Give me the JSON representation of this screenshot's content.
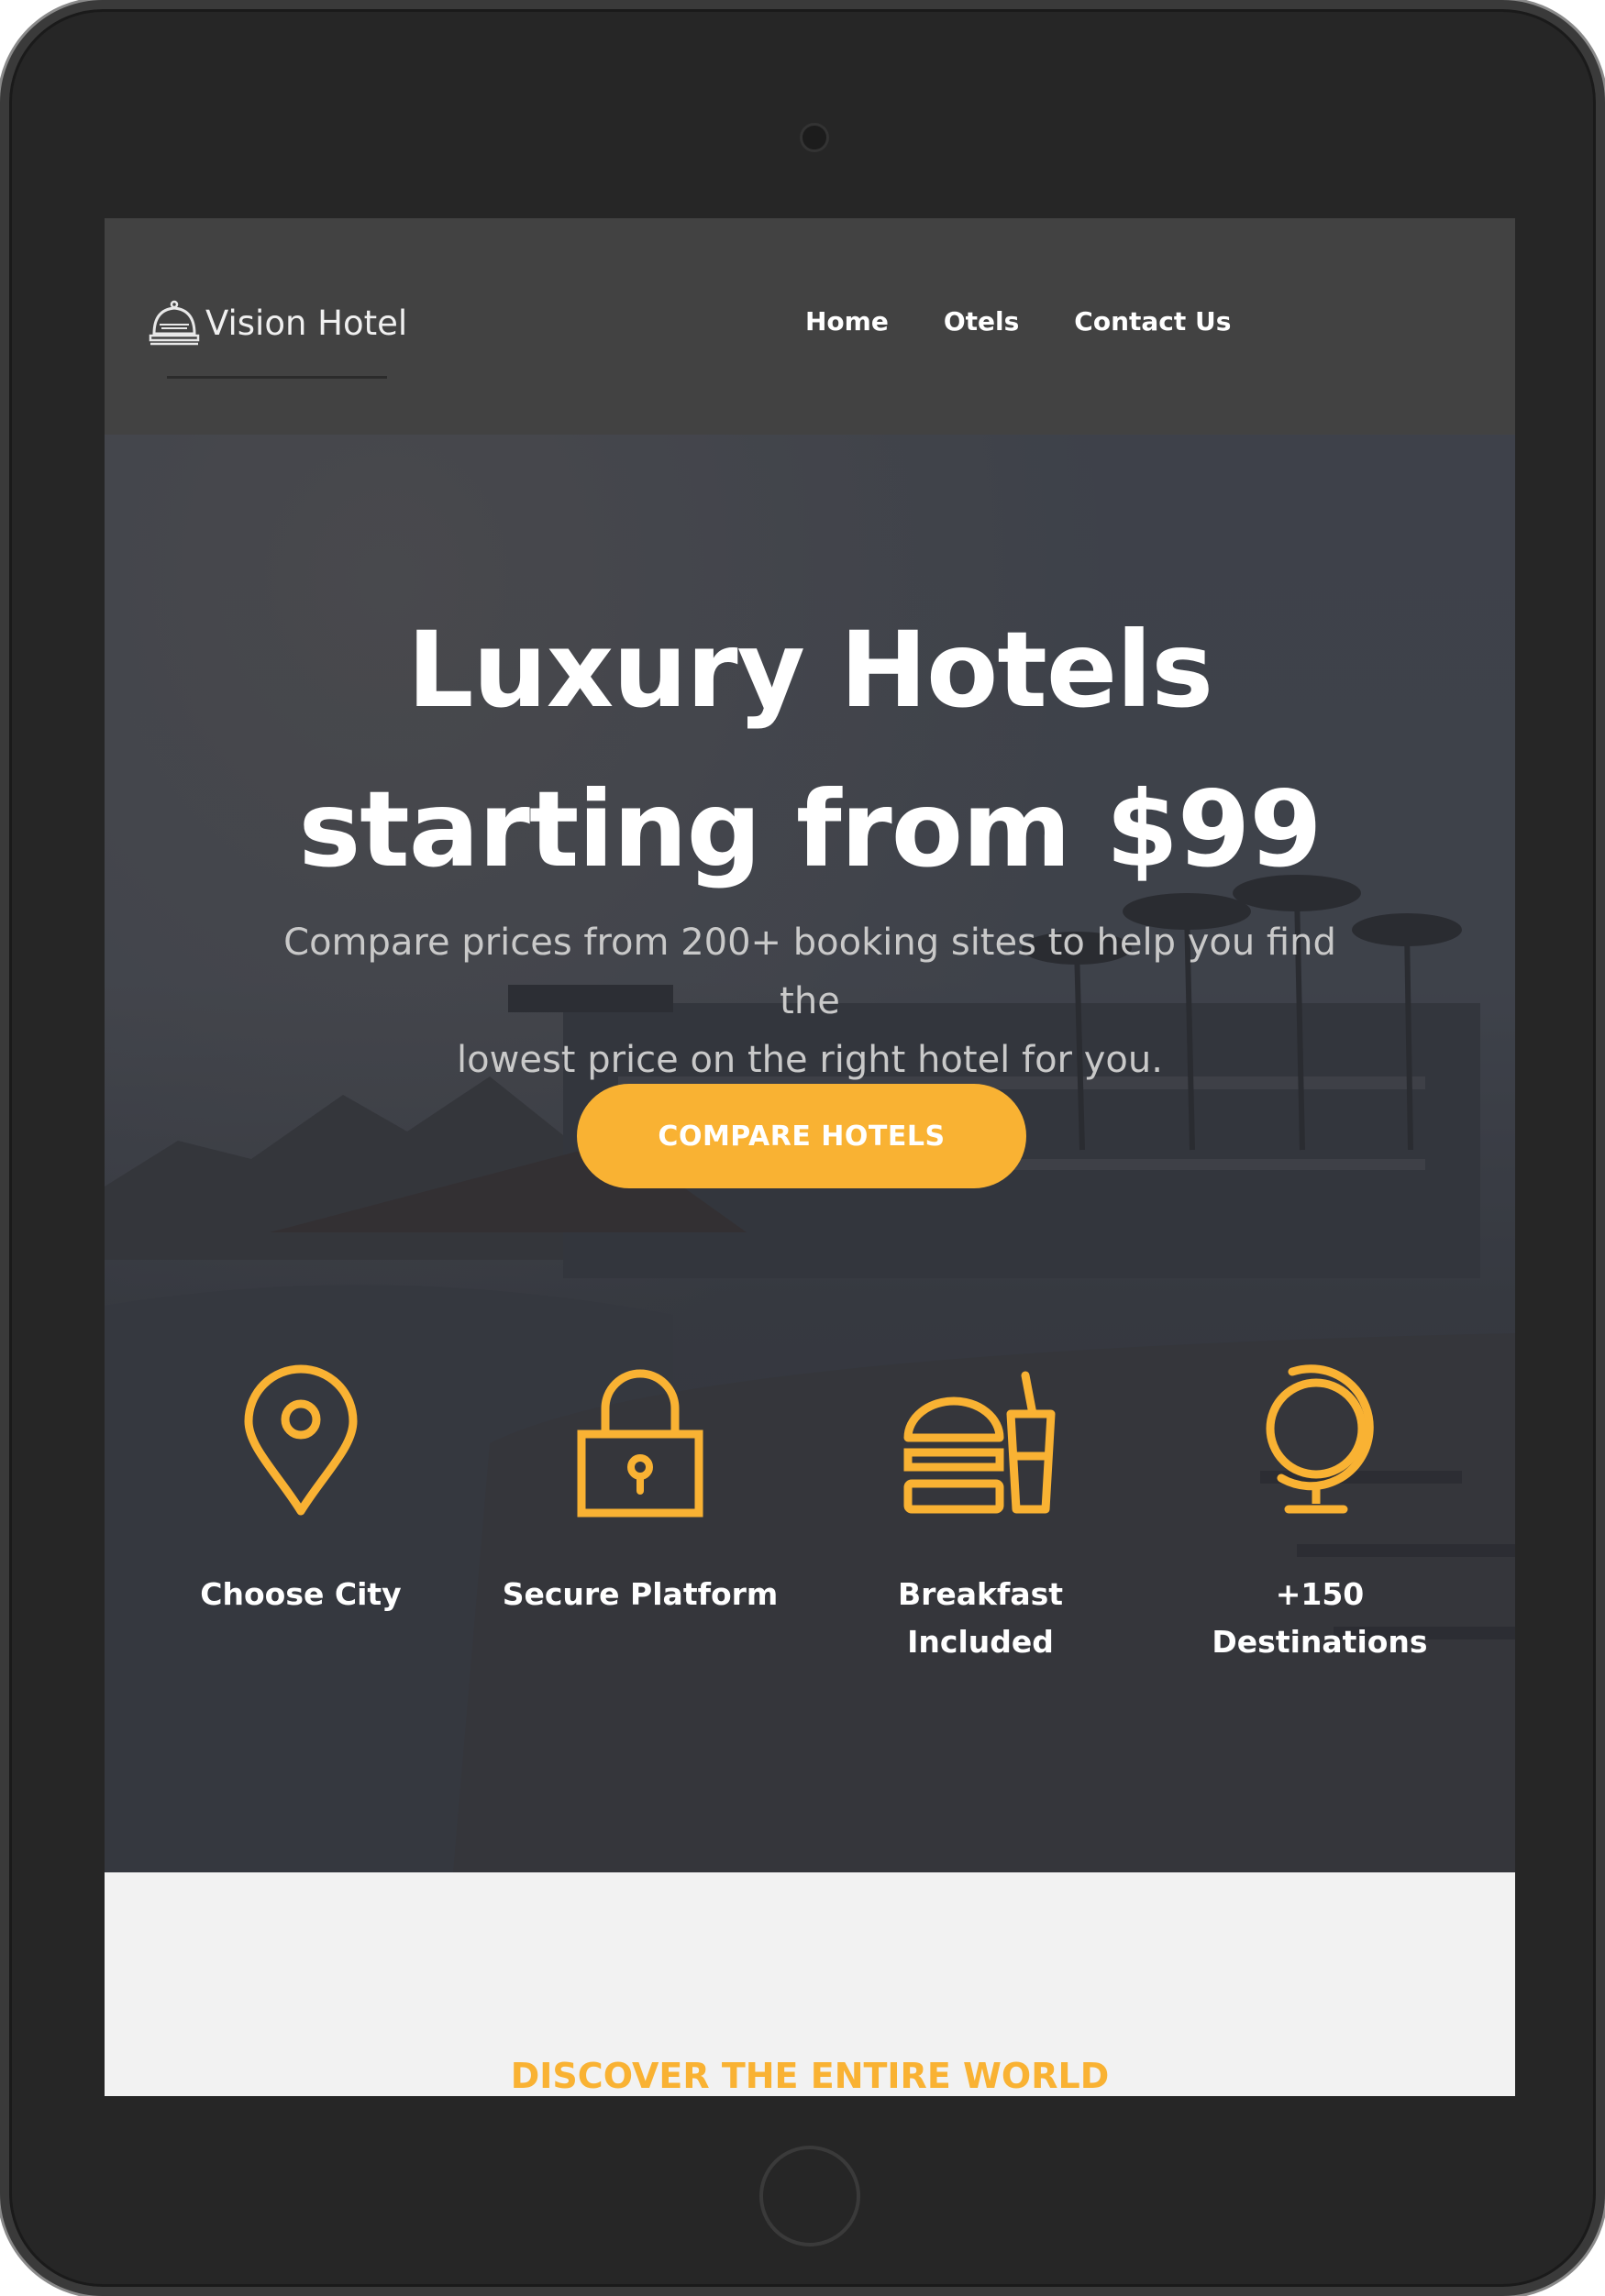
{
  "brand": {
    "name": "Vision Hotel",
    "logo_icon": "bell-icon"
  },
  "nav": {
    "items": [
      "Home",
      "Otels",
      "Contact Us"
    ]
  },
  "hero": {
    "title_line1": "Luxury Hotels",
    "title_line2": "starting from $99",
    "subtitle_line1": "Compare prices from 200+ booking sites to help you find the",
    "subtitle_line2": "lowest price on the right hotel for you.",
    "cta_label": "COMPARE HOTELS"
  },
  "features": [
    {
      "icon": "map-pin-icon",
      "line1": "Choose City",
      "line2": ""
    },
    {
      "icon": "lock-icon",
      "line1": "Secure Platform",
      "line2": ""
    },
    {
      "icon": "burger-drink-icon",
      "line1": "Breakfast",
      "line2": "Included"
    },
    {
      "icon": "globe-icon",
      "line1": "+150",
      "line2": "Destinations"
    }
  ],
  "section": {
    "title": "DISCOVER THE ENTIRE WORLD"
  },
  "colors": {
    "accent": "#f9b233",
    "navbar": "#424242",
    "bezel": "#262626"
  }
}
